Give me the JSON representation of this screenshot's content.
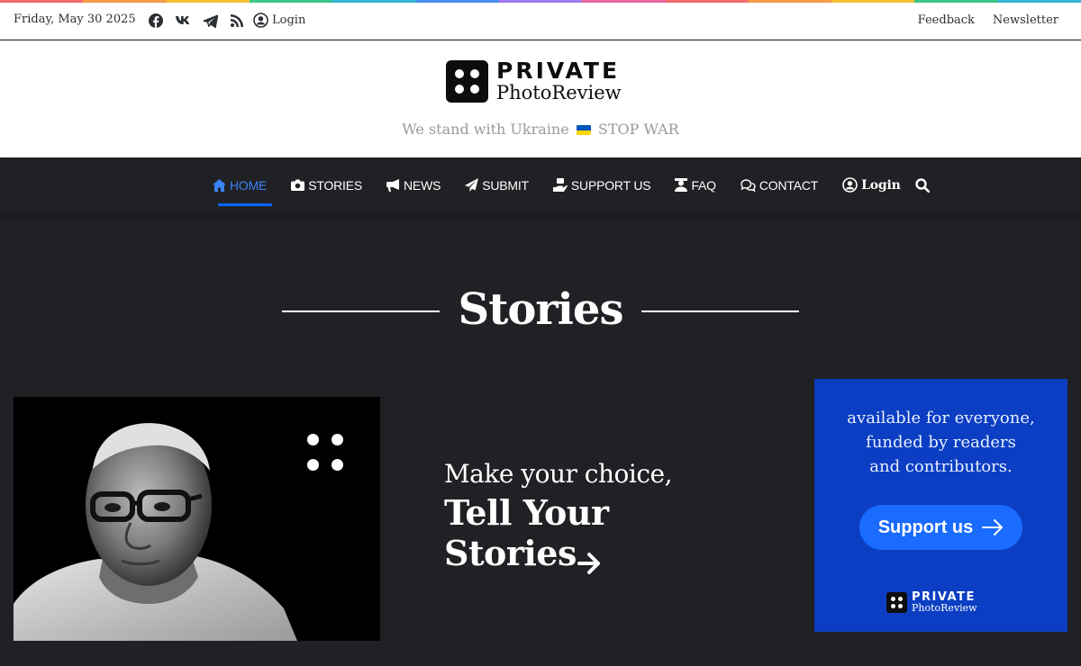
{
  "rainbow_colors": [
    "#f46b6b",
    "#f59b4c",
    "#f5c33b",
    "#3fc58a",
    "#34b6d6",
    "#4a8df0",
    "#a37cf0",
    "#e86a9e",
    "#f46b6b",
    "#f59b4c",
    "#f5c33b",
    "#3fc58a",
    "#34b6d6"
  ],
  "topbar": {
    "date": "Friday, May 30 2025",
    "social_icons": [
      "facebook-icon",
      "vk-icon",
      "telegram-icon",
      "rss-icon"
    ],
    "login_label": "Login",
    "links": [
      "Feedback",
      "Newsletter"
    ]
  },
  "header": {
    "logo_line1": "PRIVATE",
    "logo_line2": "PhotoReview",
    "tagline_before": "We stand with Ukraine",
    "tagline_after": "STOP WAR",
    "flag_colors": [
      "#0057b7",
      "#ffd700"
    ]
  },
  "nav": {
    "items": [
      {
        "label": "HOME",
        "icon": "home-icon"
      },
      {
        "label": "STORIES",
        "icon": "camera-icon"
      },
      {
        "label": "NEWS",
        "icon": "megaphone-icon"
      },
      {
        "label": "SUBMIT",
        "icon": "paper-plane-icon"
      },
      {
        "label": "SUPPORT US",
        "icon": "donate-hand-icon"
      },
      {
        "label": "FAQ",
        "icon": "person-question-icon"
      },
      {
        "label": "CONTACT",
        "icon": "chat-icon"
      }
    ],
    "login_label": "Login",
    "active_color": "#0a66ff"
  },
  "section": {
    "title": "Stories"
  },
  "promo": {
    "line1": "Make your choice,",
    "line2": "Tell Your Stories"
  },
  "ad": {
    "text_line1": "available for everyone,",
    "text_line2": "funded by readers",
    "text_line3": "and contributors.",
    "button_label": "Support us",
    "logo_line1": "PRIVATE",
    "logo_line2": "PhotoReview",
    "background": "#0b3ec2",
    "button_color": "#1a6bff"
  }
}
